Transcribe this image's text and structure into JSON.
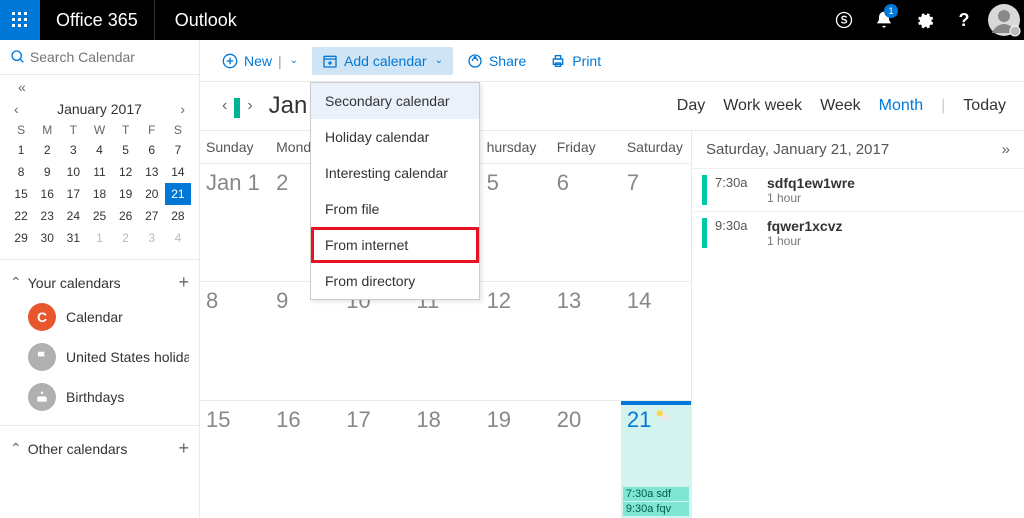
{
  "header": {
    "suite": "Office 365",
    "app": "Outlook",
    "notification_count": "1"
  },
  "search": {
    "placeholder": "Search Calendar"
  },
  "toolbar": {
    "new_label": "New",
    "add_calendar_label": "Add calendar",
    "share_label": "Share",
    "print_label": "Print"
  },
  "add_calendar_menu": {
    "items": [
      "Secondary calendar",
      "Holiday calendar",
      "Interesting calendar",
      "From file",
      "From internet",
      "From directory"
    ],
    "highlighted_index": 0,
    "boxed_index": 4
  },
  "mini_calendar": {
    "title": "January 2017",
    "weekdays": [
      "S",
      "M",
      "T",
      "W",
      "T",
      "F",
      "S"
    ],
    "weeks": [
      [
        {
          "d": "1"
        },
        {
          "d": "2"
        },
        {
          "d": "3"
        },
        {
          "d": "4"
        },
        {
          "d": "5"
        },
        {
          "d": "6"
        },
        {
          "d": "7"
        }
      ],
      [
        {
          "d": "8"
        },
        {
          "d": "9"
        },
        {
          "d": "10"
        },
        {
          "d": "11"
        },
        {
          "d": "12"
        },
        {
          "d": "13"
        },
        {
          "d": "14"
        }
      ],
      [
        {
          "d": "15"
        },
        {
          "d": "16"
        },
        {
          "d": "17"
        },
        {
          "d": "18"
        },
        {
          "d": "19"
        },
        {
          "d": "20"
        },
        {
          "d": "21",
          "sel": true
        }
      ],
      [
        {
          "d": "22"
        },
        {
          "d": "23"
        },
        {
          "d": "24"
        },
        {
          "d": "25"
        },
        {
          "d": "26"
        },
        {
          "d": "27"
        },
        {
          "d": "28"
        }
      ],
      [
        {
          "d": "29"
        },
        {
          "d": "30"
        },
        {
          "d": "31"
        },
        {
          "d": "1",
          "dim": true
        },
        {
          "d": "2",
          "dim": true
        },
        {
          "d": "3",
          "dim": true
        },
        {
          "d": "4",
          "dim": true
        }
      ]
    ]
  },
  "calendar_groups": {
    "your_calendars": {
      "title": "Your calendars",
      "items": [
        {
          "label": "Calendar",
          "color": "#e8562e",
          "initial": "C"
        },
        {
          "label": "United States holidays",
          "color": "#b0b0b0",
          "initial": ""
        },
        {
          "label": "Birthdays",
          "color": "#b0b0b0",
          "initial": ""
        }
      ]
    },
    "other_calendars": {
      "title": "Other calendars"
    }
  },
  "month_view": {
    "title_partial": "Jan",
    "view_options": {
      "day": "Day",
      "work_week": "Work week",
      "week": "Week",
      "month": "Month",
      "today": "Today",
      "active": "Month"
    },
    "day_headers": [
      "Sunday",
      "Mond",
      "hursday",
      "Friday",
      "Saturday"
    ],
    "weeks": [
      [
        {
          "n": "Jan 1"
        },
        {
          "n": "2"
        },
        {
          "n": ""
        },
        {
          "n": "5"
        },
        {
          "n": "6"
        },
        {
          "n": "7"
        }
      ],
      [
        {
          "n": "8"
        },
        {
          "n": "9"
        },
        {
          "n": "10"
        },
        {
          "n": "11"
        },
        {
          "n": "12"
        },
        {
          "n": "13"
        },
        {
          "n": "14"
        }
      ],
      [
        {
          "n": "15"
        },
        {
          "n": "16"
        },
        {
          "n": "17"
        },
        {
          "n": "18"
        },
        {
          "n": "19"
        },
        {
          "n": "20"
        },
        {
          "n": "21",
          "today": true,
          "events": [
            "7:30a  sdf",
            "9:30a  fqv"
          ]
        }
      ]
    ]
  },
  "day_detail": {
    "title": "Saturday, January 21, 2017",
    "items": [
      {
        "time": "7:30a",
        "title": "sdfq1ew1wre",
        "dur": "1 hour"
      },
      {
        "time": "9:30a",
        "title": "fqwer1xcvz",
        "dur": "1 hour"
      }
    ]
  }
}
